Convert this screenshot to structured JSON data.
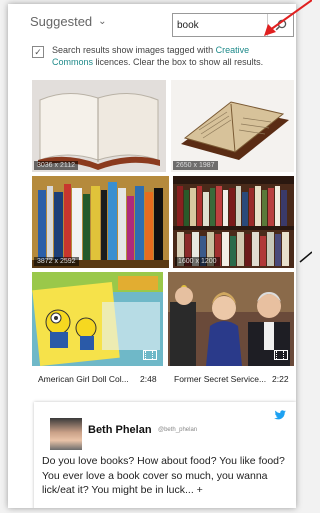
{
  "header": {
    "filter_label": "Suggested",
    "search_value": "book"
  },
  "cc_notice": {
    "prefix": "Search results show images tagged with ",
    "link": "Creative Commons",
    "suffix": " licences. Clear the box to show all results.",
    "checked": true
  },
  "images": [
    {
      "dims": "3036 x 2112"
    },
    {
      "dims": "2650 x 1987"
    },
    {
      "dims": "3872 x 2592"
    },
    {
      "dims": "1600 x 1200"
    },
    {
      "dims": ""
    },
    {
      "dims": ""
    }
  ],
  "videos": [
    {
      "title": "American Girl Doll Col...",
      "duration": "2:48"
    },
    {
      "title": "Former Secret Service...",
      "duration": "2:22"
    }
  ],
  "tweet": {
    "author": "Beth Phelan",
    "handle": "@beth_phelan",
    "text": "Do you love books? How about food? You like food? You ever love a book cover so much, you wanna lick/eat it? You might be in luck... +"
  },
  "colors": {
    "accent": "#1e8a8a",
    "annotation_arrow": "#e02020",
    "twitter": "#1da1f2"
  }
}
